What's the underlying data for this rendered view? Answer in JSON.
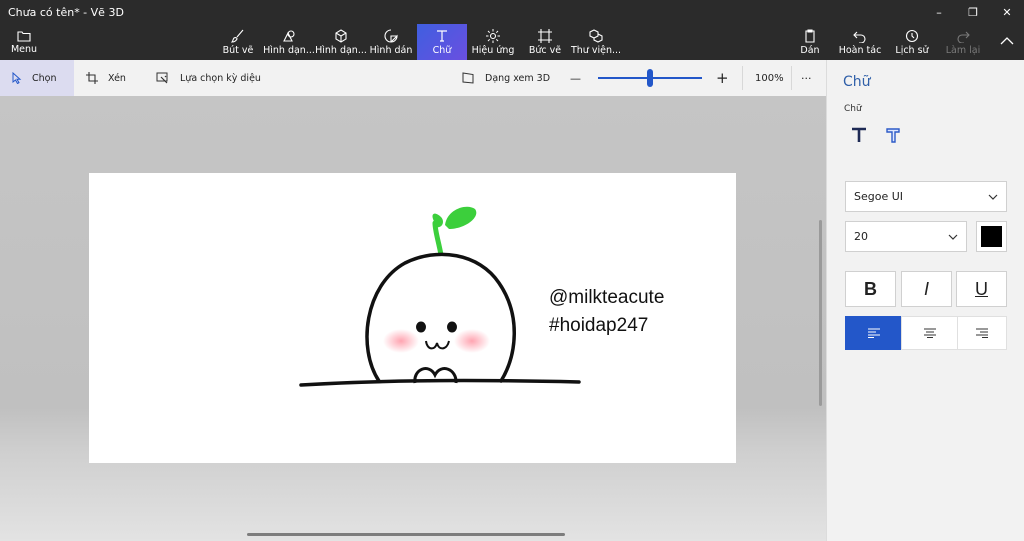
{
  "window": {
    "title": "Chưa có tên* - Vẽ 3D",
    "controls": [
      "–",
      "❐",
      "✕"
    ]
  },
  "ribbon": {
    "menu": "Menu",
    "items": [
      "Bút vẽ",
      "Hình dạn...",
      "Hình dạn...",
      "Hình dán",
      "Chữ",
      "Hiệu ứng",
      "Bức vẽ",
      "Thư viện..."
    ],
    "active": "Chữ",
    "right": [
      "Dán",
      "Hoàn tác",
      "Lịch sử",
      "Làm lại"
    ]
  },
  "subbar": {
    "select": "Chọn",
    "crop": "Xén",
    "magic_select": "Lựa chọn kỳ diệu",
    "view3d": "Dạng xem 3D",
    "zoom_minus": "—",
    "zoom_plus": "+",
    "zoom_percent": "100%",
    "zoom_value": 0.5,
    "more": "···"
  },
  "canvas": {
    "line1": "@milkteacute",
    "line2": "#hoidap247"
  },
  "panel": {
    "title": "Chữ",
    "section": "Chữ",
    "font_name": "Segoe UI",
    "font_size": "20",
    "text_color": "#000000",
    "bold": "B",
    "italic": "I",
    "underline": "U"
  },
  "colors": {
    "accent": "#2357c9",
    "sprout": "#3ccf3c",
    "blush": "#ff9aa8"
  }
}
